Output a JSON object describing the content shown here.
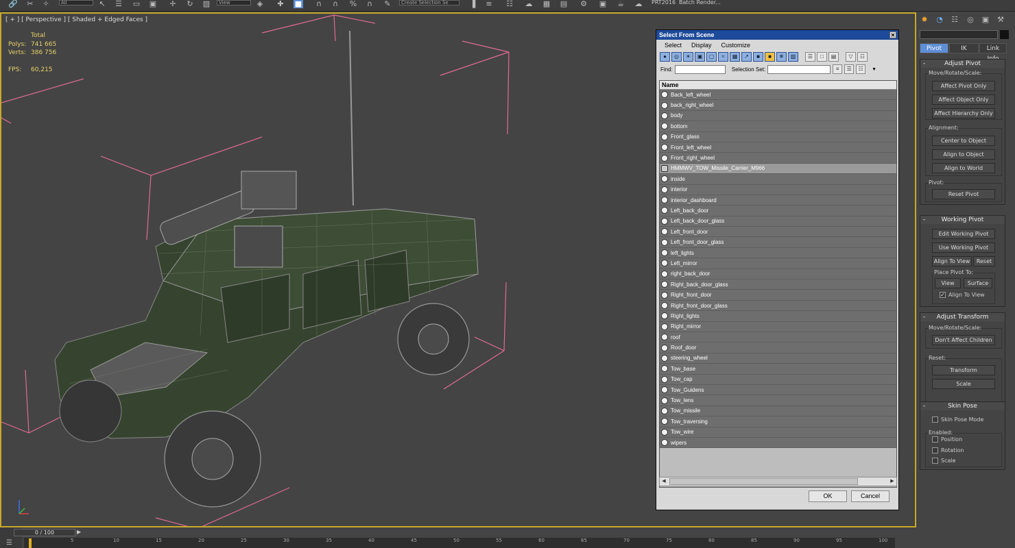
{
  "toolbar": {
    "selection_filter": "All",
    "ref_coord": "View",
    "named_selection_placeholder": "Create Selection Se",
    "prt_label": "PRT2016",
    "batch_render_label": "Batch Render..."
  },
  "viewport": {
    "label": "[ + ] [ Perspective ] [ Shaded + Edged Faces ]",
    "stats": {
      "header": "Total",
      "polys_label": "Polys:",
      "polys_value": "741 665",
      "verts_label": "Verts:",
      "verts_value": "386 756",
      "fps_label": "FPS:",
      "fps_value": "60,215"
    },
    "axis": {
      "x": "x",
      "y": "y",
      "z": "z"
    }
  },
  "dialog": {
    "title": "Select From Scene",
    "menu": [
      "Select",
      "Display",
      "Customize"
    ],
    "find_label": "Find:",
    "selection_set_label": "Selection Set:",
    "column_header": "Name",
    "items": [
      {
        "name": "Back_left_wheel",
        "selected": false
      },
      {
        "name": "back_right_wheel",
        "selected": false
      },
      {
        "name": "body",
        "selected": false
      },
      {
        "name": "bottom",
        "selected": false
      },
      {
        "name": "Front_glass",
        "selected": false
      },
      {
        "name": "Front_left_wheel",
        "selected": false
      },
      {
        "name": "Front_right_wheel",
        "selected": false
      },
      {
        "name": "HMMWV_TOW_Missile_Carrier_M966",
        "selected": true
      },
      {
        "name": "inside",
        "selected": false
      },
      {
        "name": "interior",
        "selected": false
      },
      {
        "name": "interior_dashboard",
        "selected": false
      },
      {
        "name": "Left_back_door",
        "selected": false
      },
      {
        "name": "Left_back_door_glass",
        "selected": false
      },
      {
        "name": "Left_front_door",
        "selected": false
      },
      {
        "name": "Left_front_door_glass",
        "selected": false
      },
      {
        "name": "left_lights",
        "selected": false
      },
      {
        "name": "Left_mirror",
        "selected": false
      },
      {
        "name": "right_back_door",
        "selected": false
      },
      {
        "name": "Right_back_door_glass",
        "selected": false
      },
      {
        "name": "Right_front_door",
        "selected": false
      },
      {
        "name": "Right_front_door_glass",
        "selected": false
      },
      {
        "name": "Right_lights",
        "selected": false
      },
      {
        "name": "Right_mirror",
        "selected": false
      },
      {
        "name": "roof",
        "selected": false
      },
      {
        "name": "Roof_door",
        "selected": false
      },
      {
        "name": "steering_wheel",
        "selected": false
      },
      {
        "name": "Tow_base",
        "selected": false
      },
      {
        "name": "Tow_cap",
        "selected": false
      },
      {
        "name": "Tow_Guidens",
        "selected": false
      },
      {
        "name": "Tow_lens",
        "selected": false
      },
      {
        "name": "Tow_missile",
        "selected": false
      },
      {
        "name": "Tow_traversing",
        "selected": false
      },
      {
        "name": "Tow_wire",
        "selected": false
      },
      {
        "name": "wipers",
        "selected": false
      }
    ],
    "ok_label": "OK",
    "cancel_label": "Cancel"
  },
  "command_panel": {
    "tabs": [
      "Pivot",
      "IK",
      "Link Info"
    ],
    "active_tab": "Pivot",
    "adjust_pivot": {
      "title": "Adjust Pivot",
      "move_group": "Move/Rotate/Scale:",
      "affect_pivot": "Affect Pivot Only",
      "affect_object": "Affect Object Only",
      "affect_hierarchy": "Affect Hierarchy Only",
      "alignment_group": "Alignment:",
      "center_to_object": "Center to Object",
      "align_to_object": "Align to Object",
      "align_to_world": "Align to World",
      "pivot_group": "Pivot:",
      "reset_pivot": "Reset Pivot"
    },
    "working_pivot": {
      "title": "Working Pivot",
      "edit": "Edit Working Pivot",
      "use": "Use Working Pivot",
      "align_to_view": "Align To View",
      "reset": "Reset",
      "place_group": "Place Pivot To:",
      "view": "View",
      "surface": "Surface",
      "align_to_view_check": "Align To View"
    },
    "adjust_transform": {
      "title": "Adjust Transform",
      "move_group": "Move/Rotate/Scale:",
      "dont_affect_children": "Don't Affect Children",
      "reset_group": "Reset:",
      "transform": "Transform",
      "scale": "Scale"
    },
    "skin_pose": {
      "title": "Skin Pose",
      "skin_pose_mode": "Skin Pose Mode",
      "enabled_group": "Enabled:",
      "position": "Position",
      "rotation": "Rotation",
      "scale": "Scale"
    },
    "rollout_toggle": "-"
  },
  "timeline": {
    "frame_display": "0 / 100",
    "ticks": [
      "5",
      "10",
      "15",
      "20",
      "25",
      "30",
      "35",
      "40",
      "45",
      "50",
      "55",
      "60",
      "65",
      "70",
      "75",
      "80",
      "85",
      "90",
      "95",
      "100"
    ]
  }
}
